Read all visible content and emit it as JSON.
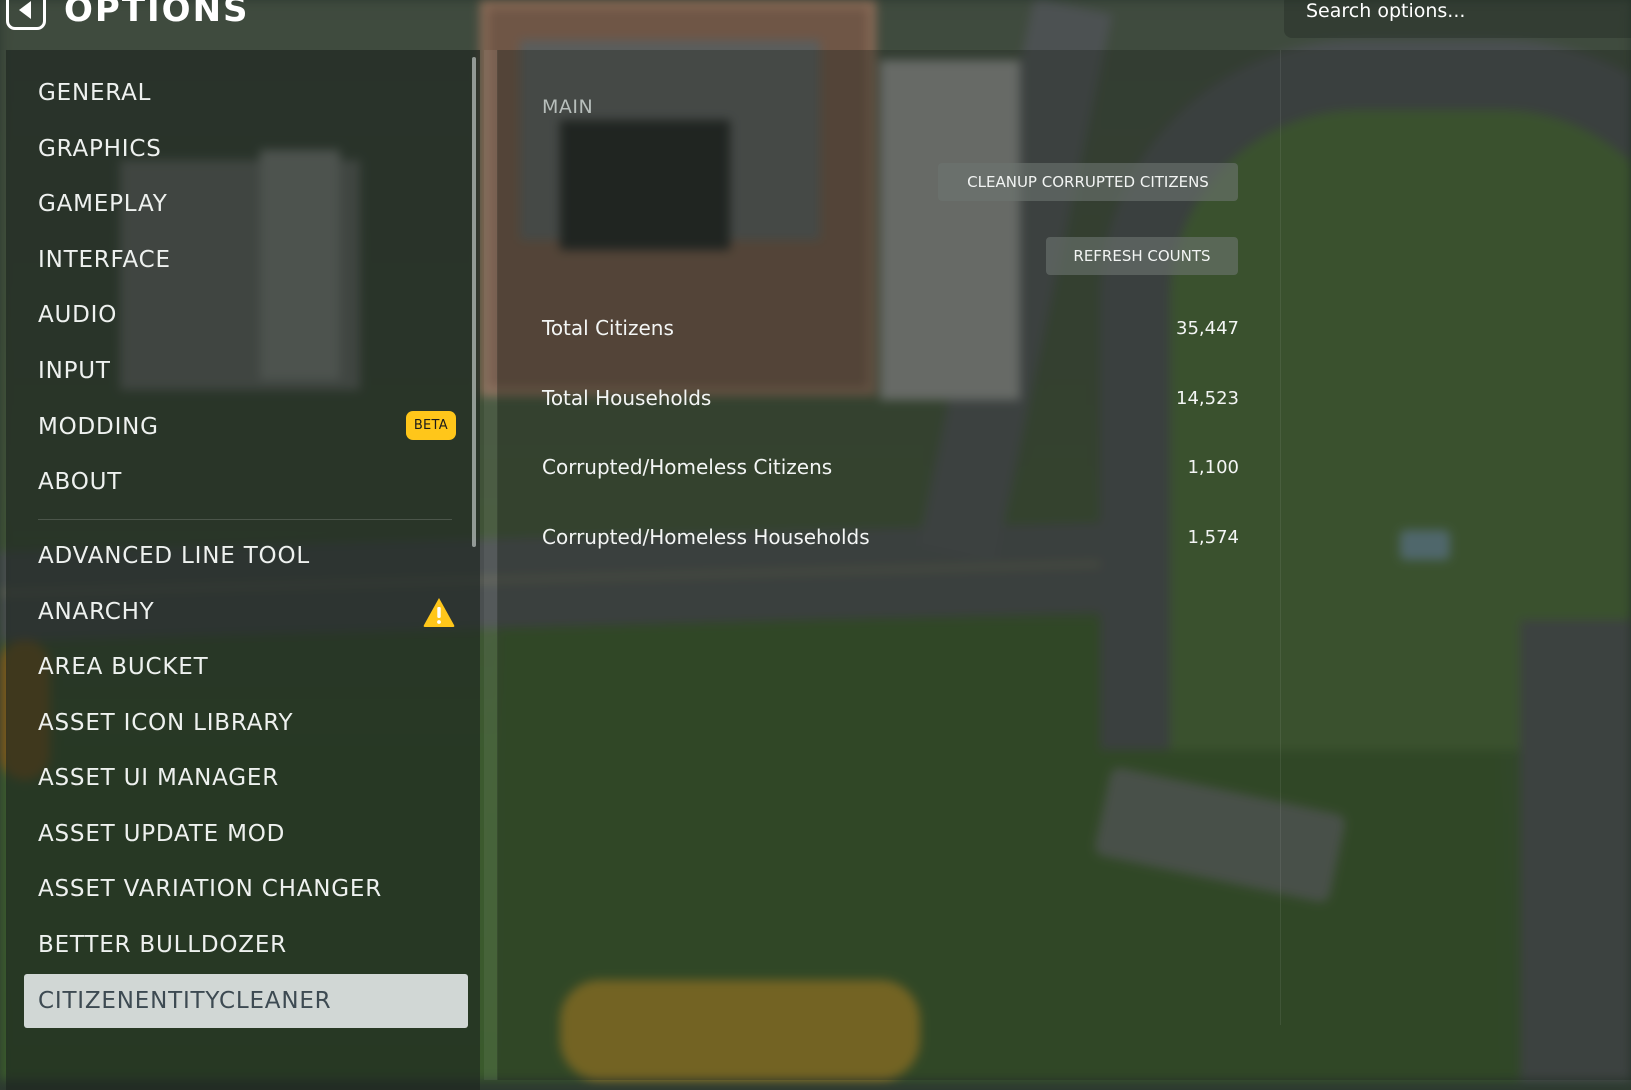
{
  "header": {
    "title": "OPTIONS",
    "back_icon": "back-arrow-icon",
    "search": {
      "placeholder": "Search options..."
    }
  },
  "sidebar": {
    "core_items": [
      {
        "label": "GENERAL"
      },
      {
        "label": "GRAPHICS"
      },
      {
        "label": "GAMEPLAY"
      },
      {
        "label": "INTERFACE"
      },
      {
        "label": "AUDIO"
      },
      {
        "label": "INPUT"
      },
      {
        "label": "MODDING",
        "badge": "BETA"
      },
      {
        "label": "ABOUT"
      }
    ],
    "mod_items": [
      {
        "label": "ADVANCED LINE TOOL"
      },
      {
        "label": "ANARCHY",
        "icon": "warning-icon"
      },
      {
        "label": "AREA BUCKET"
      },
      {
        "label": "ASSET ICON LIBRARY"
      },
      {
        "label": "ASSET UI MANAGER"
      },
      {
        "label": "ASSET UPDATE MOD"
      },
      {
        "label": "ASSET VARIATION CHANGER"
      },
      {
        "label": "BETTER BULLDOZER"
      },
      {
        "label": "CITIZENENTITYCLEANER",
        "selected": true
      }
    ]
  },
  "main": {
    "section_title": "MAIN",
    "buttons": {
      "cleanup": "CLEANUP CORRUPTED CITIZENS",
      "refresh": "REFRESH COUNTS"
    },
    "stats": [
      {
        "label": "Total Citizens",
        "value": "35,447"
      },
      {
        "label": "Total Households",
        "value": "14,523"
      },
      {
        "label": "Corrupted/Homeless Citizens",
        "value": "1,100"
      },
      {
        "label": "Corrupted/Homeless Households",
        "value": "1,574"
      }
    ]
  },
  "colors": {
    "badge": "#ffc61a",
    "warning": "#ffc61a",
    "selected_bg": "#e4e9e9",
    "selected_text": "#3d4a52"
  }
}
